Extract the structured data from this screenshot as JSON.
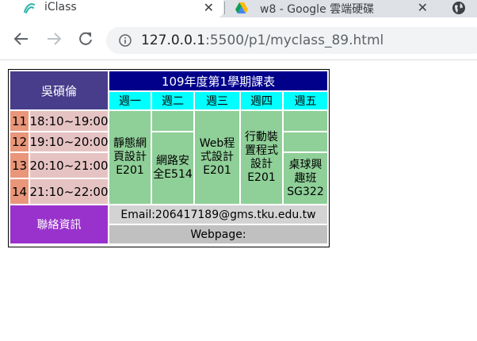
{
  "browser": {
    "tabs": [
      {
        "title": "iClass",
        "active": true
      },
      {
        "title": "w8 - Google 雲端硬碟",
        "active": false
      }
    ],
    "url_host": "127.0.0.1",
    "url_path": ":5500/p1/myclass_89.html"
  },
  "schedule": {
    "name": "吳碩倫",
    "title": "109年度第1學期課表",
    "days": [
      "週一",
      "週二",
      "週三",
      "週四",
      "週五"
    ],
    "periods": [
      {
        "num": "11",
        "time": "18:10~19:00"
      },
      {
        "num": "12",
        "time": "19:10~20:00"
      },
      {
        "num": "13",
        "time": "20:10~21:00"
      },
      {
        "num": "14",
        "time": "21:10~22:00"
      }
    ],
    "courses": {
      "mon": "靜態網頁設計E201",
      "tue": "網路安全E514",
      "wed": "Web程式設計E201",
      "thu": "行動裝置程式設計E201",
      "fri": "桌球興趣班SG322"
    },
    "contact_label": "聯絡資訊",
    "email": "Email:206417189@gms.tku.edu.tw",
    "webpage": "Webpage:"
  },
  "colors": {
    "name_bg": "#483d8b",
    "title_bg": "#00008b",
    "day_bg": "#00ffff",
    "num_bg": "#e9967a",
    "time_bg": "#e6c3c3",
    "course_bg": "#8fcf98",
    "contact_bg": "#9932cc",
    "email_bg": "#d3d3d3",
    "web_bg": "#c0c0c0"
  }
}
